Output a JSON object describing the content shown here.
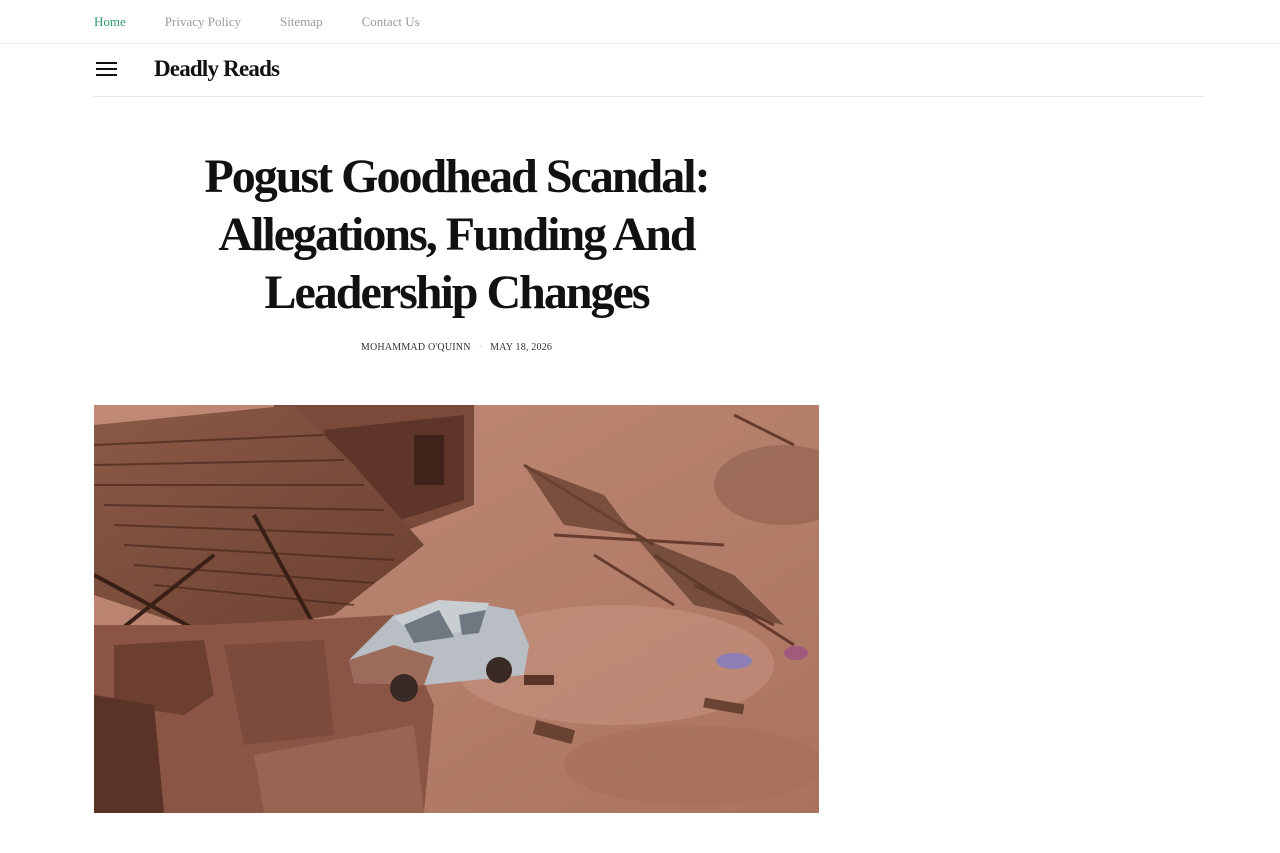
{
  "topnav": {
    "items": [
      {
        "label": "Home",
        "active": true
      },
      {
        "label": "Privacy Policy",
        "active": false
      },
      {
        "label": "Sitemap",
        "active": false
      },
      {
        "label": "Contact Us",
        "active": false
      }
    ],
    "active_color": "#2e9a6a"
  },
  "header": {
    "menu_icon": "hamburger-menu-icon",
    "site_title": "Deadly Reads"
  },
  "article": {
    "title": "Pogust Goodhead Scandal: Allegations, Funding And Leadership Changes",
    "author": "MOHAMMAD O'QUINN",
    "separator": "·",
    "date": "MAY 18, 2026"
  },
  "hero_image": {
    "subject": "aerial view of mudslide-damaged houses with a car stranded in reddish mud"
  }
}
